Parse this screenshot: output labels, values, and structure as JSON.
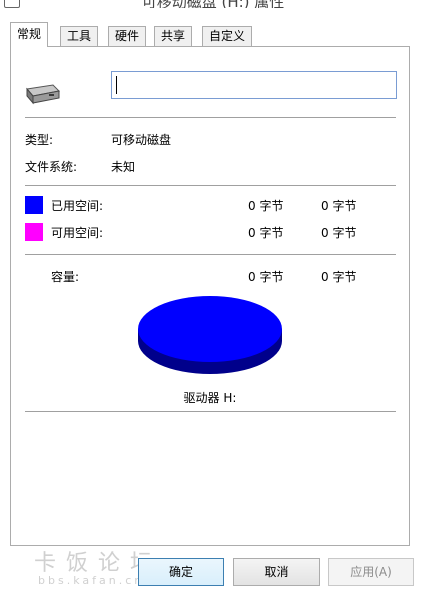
{
  "window": {
    "title": "可移动磁盘 (H:) 属性"
  },
  "tabs": [
    {
      "label": "常规",
      "active": true
    },
    {
      "label": "工具",
      "active": false
    },
    {
      "label": "硬件",
      "active": false
    },
    {
      "label": "共享",
      "active": false
    },
    {
      "label": "自定义",
      "active": false
    }
  ],
  "general": {
    "drive_name_value": "",
    "type_label": "类型:",
    "type_value": "可移动磁盘",
    "fs_label": "文件系统:",
    "fs_value": "未知",
    "used_label": "已用空间:",
    "used_bytes": "0 字节",
    "used_size": "0 字节",
    "free_label": "可用空间:",
    "free_bytes": "0 字节",
    "free_size": "0 字节",
    "capacity_label": "容量:",
    "capacity_bytes": "0 字节",
    "capacity_size": "0 字节",
    "drive_label": "驱动器 H:"
  },
  "colors": {
    "used": "#0000ff",
    "free": "#ff00ff",
    "pie_top": "#0000ff",
    "pie_side": "#00008b"
  },
  "buttons": {
    "ok": "确定",
    "cancel": "取消",
    "apply": "应用(A)"
  },
  "watermark": {
    "text": "卡饭论坛",
    "url": "bbs.kafan.cn"
  },
  "icons": {
    "drive": "removable-drive-icon"
  }
}
